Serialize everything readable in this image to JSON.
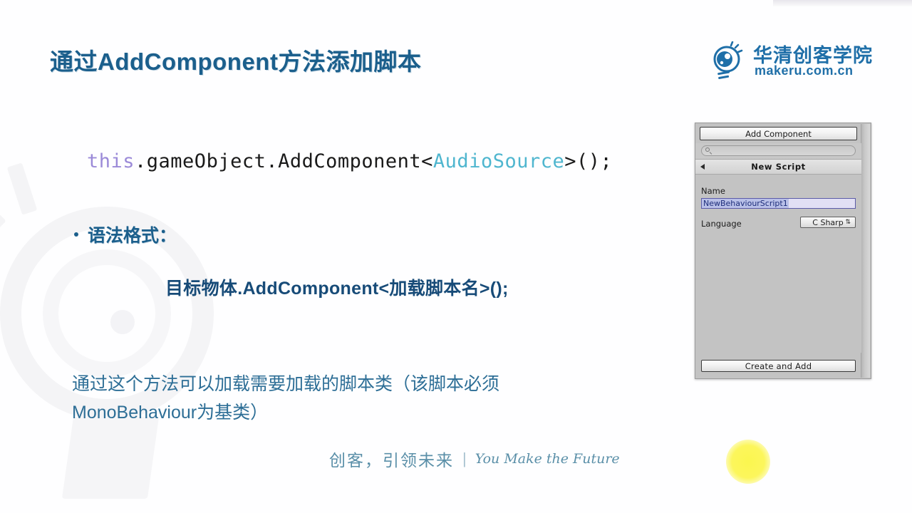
{
  "slide": {
    "title": "通过AddComponent方法添加脚本",
    "code": {
      "keyword": "this",
      "middle": ".gameObject.AddComponent<",
      "type": "AudioSource",
      "tail": ">();"
    },
    "bullet_label": "语法格式：",
    "syntax": "目标物体.AddComponent<加载脚本名>();",
    "paragraph": "通过这个方法可以加载需要加载的脚本类（该脚本必须MonoBehaviour为基类）"
  },
  "logo": {
    "icon": "lightbulb-eye-icon",
    "name_cn": "华清创客学院",
    "domain": "makeru.com.cn"
  },
  "footer": {
    "slogan_cn": "创客，引领未来",
    "divider": "|",
    "slogan_en": "You Make the Future"
  },
  "unity_panel": {
    "add_component_button": "Add Component",
    "search_placeholder": "",
    "search_icon": "magnifier-icon",
    "back_icon": "left-triangle-icon",
    "section_title": "New Script",
    "name_label": "Name",
    "name_value": "NewBehaviourScript1",
    "language_label": "Language",
    "language_value": "C Sharp",
    "language_arrows": "⇅",
    "create_button": "Create and Add"
  },
  "colors": {
    "title": "#1b5f8c",
    "accent_blue": "#1f6fa8",
    "code_keyword": "#9b8ad8",
    "code_type": "#4fb6cf",
    "paragraph": "#2d6e96",
    "cursor_glow": "#fbf64f"
  }
}
